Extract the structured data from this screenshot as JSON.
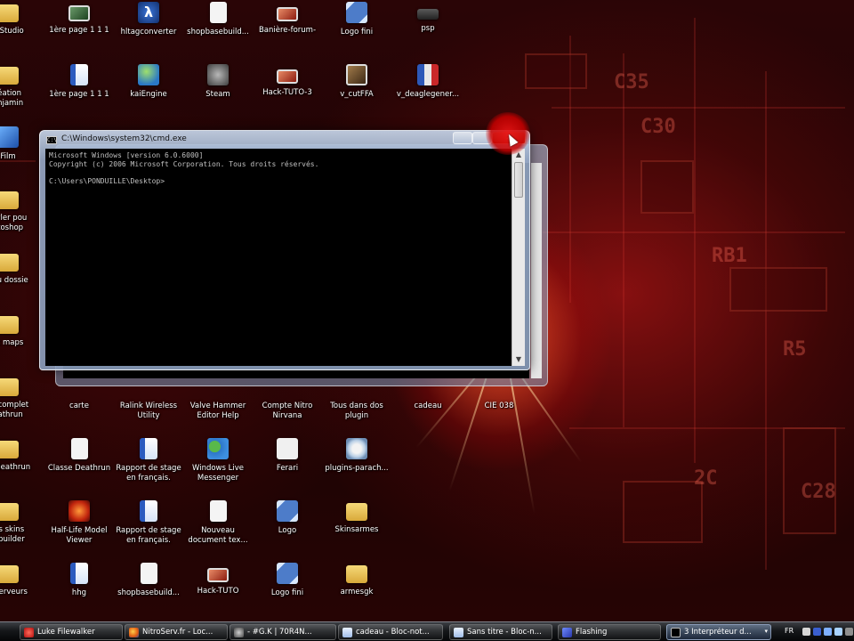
{
  "desktop": {
    "icons": [
      {
        "label": "mStudio",
        "glyph": "folder-icon"
      },
      {
        "label": "1ère page 1 1 1",
        "glyph": "image-icon"
      },
      {
        "label": "hltagconverter",
        "glyph": "lambda-app-icon"
      },
      {
        "label": "shopbasebuild...",
        "glyph": "document-icon"
      },
      {
        "label": "Banière-forum-",
        "glyph": "image-icon"
      },
      {
        "label": "Logo fini",
        "glyph": "image-icon"
      },
      {
        "label": "psp",
        "glyph": "psp-icon"
      },
      {
        "label": "réation",
        "label2": "anjamin",
        "glyph": "folder-icon"
      },
      {
        "label": "1ère page 1 1 1",
        "glyph": "word-document-icon"
      },
      {
        "label": "kaiEngine",
        "glyph": "globe-icon"
      },
      {
        "label": "Steam",
        "glyph": "steam-icon"
      },
      {
        "label": "Hack-TUTO-3",
        "glyph": "image-icon"
      },
      {
        "label": "v_cutFFA",
        "glyph": "photo-icon"
      },
      {
        "label": "v_deaglegener...",
        "glyph": "flag-image-icon"
      },
      {
        "label": "Film",
        "glyph": "monitor-icon"
      },
      {
        "label": "styler pou",
        "label2": "otoshop",
        "glyph": "folder-icon"
      },
      {
        "label": "eau dossie",
        "glyph": "folder-icon"
      },
      {
        "label": "et maps",
        "glyph": "folder-icon"
      },
      {
        "label": "ur complet",
        "label2": "eathrun",
        "glyph": "folder-icon"
      },
      {
        "label": "carte",
        "glyph": "image-icon"
      },
      {
        "label": "Ralink Wireless",
        "label2": "Utility",
        "glyph": "wireless-icon"
      },
      {
        "label": "Valve Hammer",
        "label2": "Editor Help",
        "glyph": "help-icon"
      },
      {
        "label": "Compte Nitro",
        "label2": "Nirvana",
        "glyph": "document-icon"
      },
      {
        "label": "Tous dans dos",
        "label2": "plugin",
        "glyph": "folder-icon"
      },
      {
        "label": "cadeau",
        "glyph": "document-icon"
      },
      {
        "label": "CIE 038",
        "glyph": "image-icon"
      },
      {
        "label": "ar deathrun",
        "glyph": "folder-icon"
      },
      {
        "label": "Classe Deathrun",
        "glyph": "document-icon"
      },
      {
        "label": "Rapport de stage",
        "label2": "en français.",
        "glyph": "word-document-icon"
      },
      {
        "label": "Windows Live",
        "label2": "Messenger",
        "glyph": "messenger-icon"
      },
      {
        "label": "Ferari",
        "glyph": "image-icon"
      },
      {
        "label": "plugins-parach...",
        "glyph": "gear-document-icon"
      },
      {
        "label": "les skins",
        "label2": "e builder",
        "glyph": "folder-icon"
      },
      {
        "label": "Half-Life Model",
        "label2": "Viewer",
        "glyph": "half-life-icon"
      },
      {
        "label": "Rapport de stage",
        "label2": "en français.",
        "glyph": "word-document-icon"
      },
      {
        "label": "Nouveau",
        "label2": "document tex...",
        "glyph": "document-icon"
      },
      {
        "label": "Logo",
        "glyph": "image-icon"
      },
      {
        "label": "Skinsarmes",
        "glyph": "folder-icon"
      },
      {
        "label": "s serveurs",
        "glyph": "folder-icon"
      },
      {
        "label": "hhg",
        "glyph": "word-document-icon"
      },
      {
        "label": "shopbasebuild...",
        "glyph": "document-icon"
      },
      {
        "label": "Hack-TUTO",
        "glyph": "image-icon"
      },
      {
        "label": "Logo fini",
        "glyph": "image-icon"
      },
      {
        "label": "armesgk",
        "glyph": "folder-icon"
      }
    ]
  },
  "cmd": {
    "title": "C:\\Windows\\system32\\cmd.exe",
    "console_text": "Microsoft Windows [version 6.0.6000]\nCopyright (c) 2006 Microsoft Corporation. Tous droits réservés.\n\nC:\\Users\\PONDUILLE\\Desktop>",
    "close_glyph": "✕",
    "scroll_up": "▲",
    "scroll_down": "▼",
    "app_icon_text": "C:\\"
  },
  "taskbar": {
    "buttons": [
      {
        "label": "Luke Filewalker",
        "icon": "luke-filewalker-icon"
      },
      {
        "label": "NitroServ.fr - Loc...",
        "icon": "firefox-icon"
      },
      {
        "label": "- #G.K | 70R4N...",
        "icon": "steam-icon"
      },
      {
        "label": "cadeau - Bloc-not...",
        "icon": "notepad-icon"
      },
      {
        "label": "Sans titre - Bloc-n...",
        "icon": "notepad-icon"
      },
      {
        "label": "Flashing",
        "icon": "flashing-icon"
      },
      {
        "label": "3 Interpréteur d...",
        "icon": "cmd-icon",
        "more": "▾"
      }
    ],
    "tray": {
      "language": "FR"
    }
  }
}
